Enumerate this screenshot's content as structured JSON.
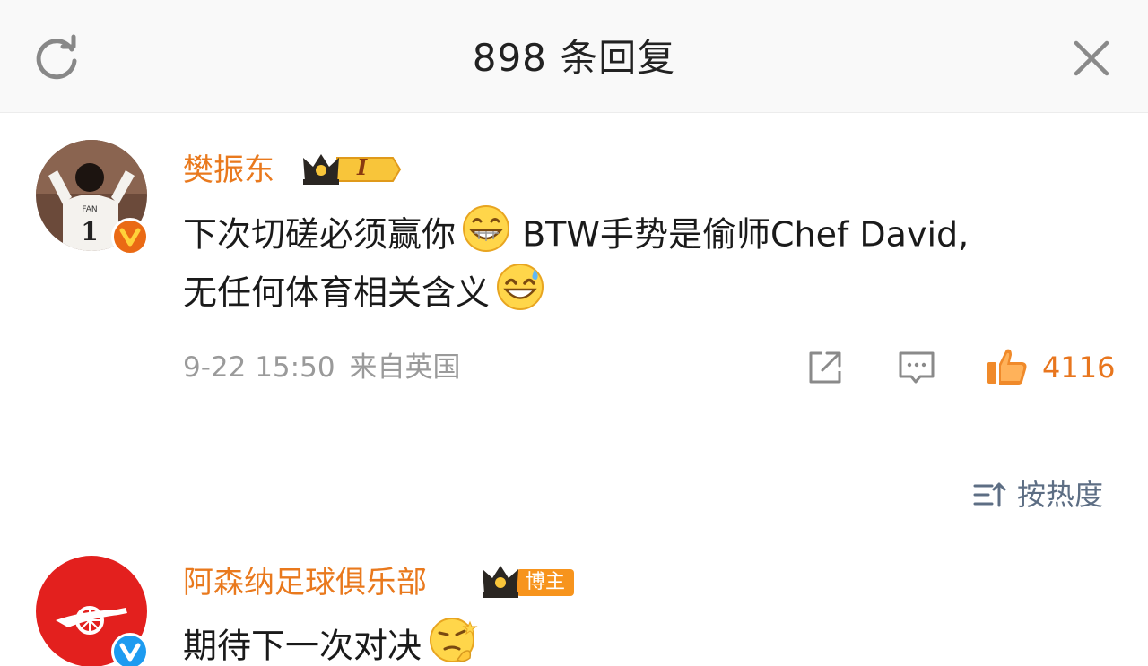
{
  "header": {
    "title": "898 条回复"
  },
  "colors": {
    "accent_orange": "#e9791d",
    "meta_gray": "#9a9a9a",
    "sort_blue_gray": "#5d6e84",
    "verified_orange": "#ea6a14",
    "verified_blue": "#1d9bf0"
  },
  "icons": {
    "refresh": "refresh-icon",
    "close": "close-icon",
    "share": "share-icon",
    "comment": "comment-icon",
    "like": "thumbs-up-icon",
    "sort": "sort-icon"
  },
  "main_comment": {
    "username": "樊振东",
    "level_badge": "I",
    "text_part1": "下次切磋必须赢你",
    "text_part2": " BTW手势是偷师Chef David,",
    "text_line2": "无任何体育相关含义",
    "date": "9-22 15:50",
    "location": "来自英国",
    "like_count": "4116"
  },
  "sort": {
    "label": "按热度"
  },
  "reply": {
    "username": "阿森纳足球俱乐部",
    "badge_label": "博主",
    "text": "期待下一次对决"
  }
}
